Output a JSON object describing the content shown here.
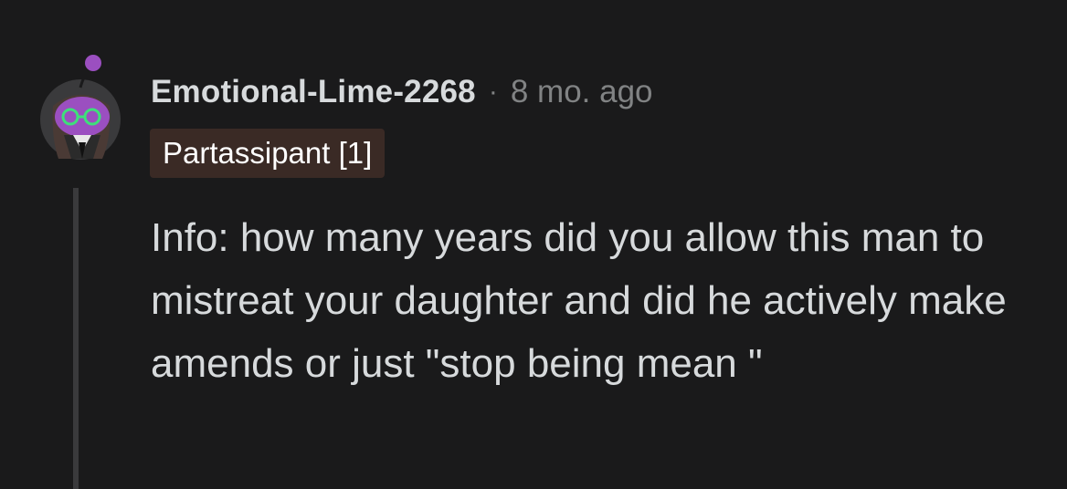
{
  "comment": {
    "author": "Emotional-Lime-2268",
    "separator": "·",
    "time_ago": "8 mo. ago",
    "flair": "Partassipant [1]",
    "body": "Info: how many years did you allow this man to mistreat your daughter and did he actively make amends or just \"stop being mean \""
  },
  "avatar": {
    "icon": "snoo-avatar-icon",
    "colors": {
      "face": "#9b4fc0",
      "hair": "#4a3a35",
      "glasses": "#3ee07a",
      "background": "#3a3a3c"
    }
  },
  "colors": {
    "background": "#1a1a1b",
    "text": "#d7dadc",
    "meta": "#818384",
    "flair_bg": "#3a2a25",
    "thread_line": "#3a3a3c"
  }
}
